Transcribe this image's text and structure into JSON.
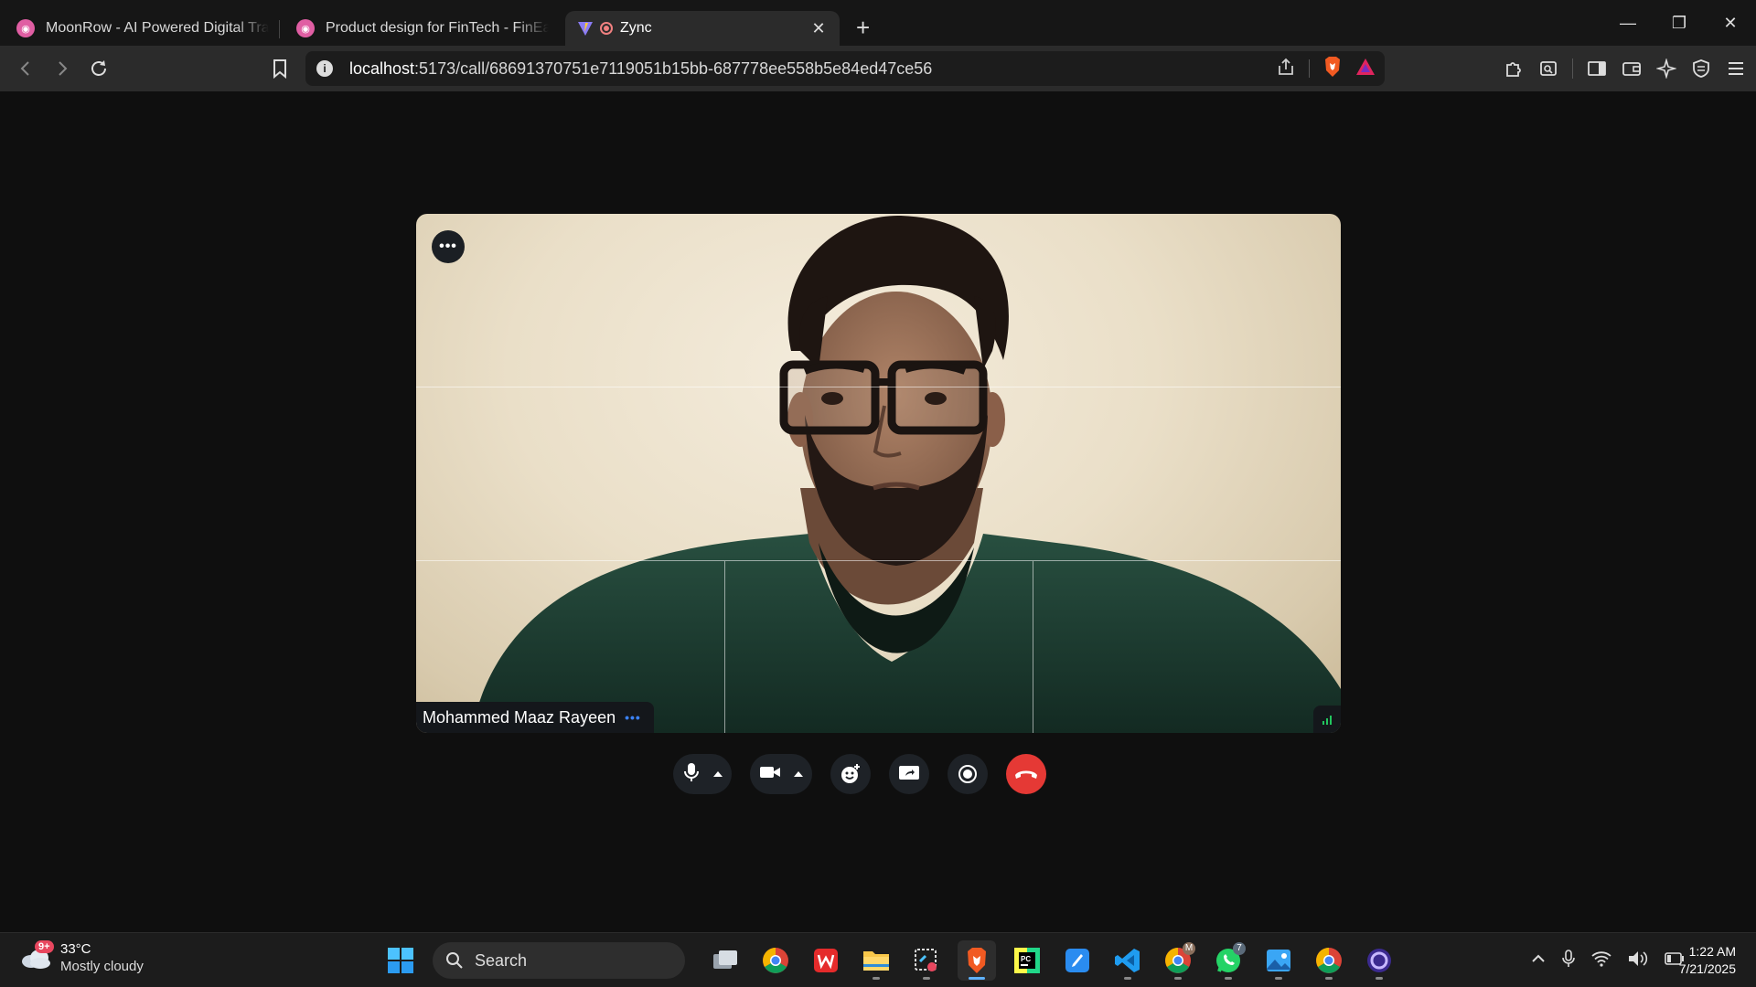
{
  "browser": {
    "tabs": [
      {
        "title": "MoonRow - AI Powered Digital Transf",
        "active": false
      },
      {
        "title": "Product design for FinTech - FinEase",
        "active": false
      },
      {
        "title": "Zync",
        "active": true
      }
    ],
    "new_tab_label": "+",
    "url_host": "localhost",
    "url_rest": ":5173/call/68691370751e7119051b15bb-687778ee558b5e84ed47ce56"
  },
  "call": {
    "participant_name": "Mohammed Maaz Rayeen",
    "more_label": "•••",
    "name_options_label": "•••",
    "controls": [
      "microphone",
      "camera",
      "reactions",
      "screen-share",
      "record",
      "end-call"
    ]
  },
  "taskbar": {
    "weather_badge": "9+",
    "temperature": "33°C",
    "weather_desc": "Mostly cloudy",
    "search_label": "Search",
    "whatsapp_count": "7",
    "time": "1:22 AM",
    "date": "7/21/2025"
  },
  "colors": {
    "end_call": "#e53935",
    "accent_blue": "#3b82f6",
    "signal_green": "#22c55e"
  }
}
